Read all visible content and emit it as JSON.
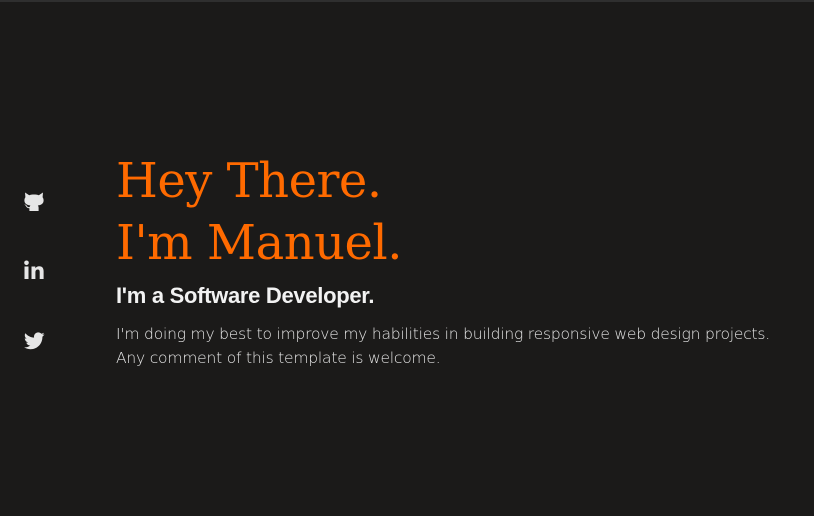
{
  "social": {
    "items": [
      {
        "icon": "github-icon"
      },
      {
        "icon": "linkedin-icon"
      },
      {
        "icon": "twitter-icon"
      }
    ]
  },
  "hero": {
    "headline_line1": "Hey There.",
    "headline_line2": "I'm Manuel.",
    "subtitle": "I'm a Software Developer.",
    "intro_line1": "I'm doing my best to improve my habilities in building responsive web design projects.",
    "intro_line2": "Any comment of this template is welcome."
  },
  "colors": {
    "background": "#1b1a19",
    "accent": "#ff6a00",
    "text": "#f2f2f2"
  }
}
